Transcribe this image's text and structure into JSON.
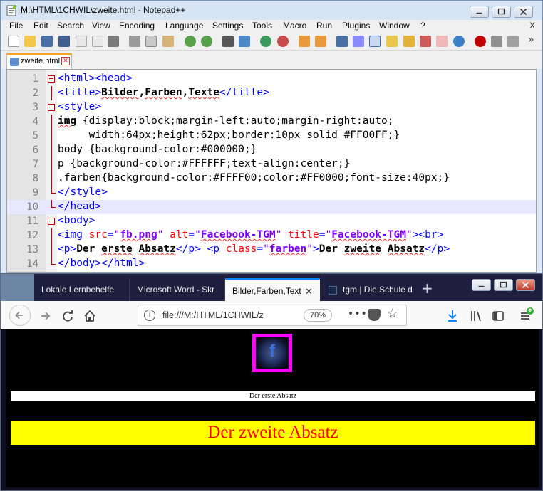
{
  "notepad": {
    "title": "M:\\HTML\\1CHWIL\\zweite.html - Notepad++",
    "menu": [
      "File",
      "Edit",
      "Search",
      "View",
      "Encoding",
      "Language",
      "Settings",
      "Tools",
      "Macro",
      "Run",
      "Plugins",
      "Window",
      "?"
    ],
    "menu_close": "X",
    "toolbar_overflow": "»",
    "tab": {
      "label": "zweite.html",
      "close": "✕"
    },
    "current_line": 10,
    "lines": [
      {
        "n": "1",
        "fold": "box",
        "parts": [
          [
            "tag",
            "<html><head>"
          ]
        ]
      },
      {
        "n": "2",
        "fold": "vline",
        "parts": [
          [
            "tag",
            "<title>"
          ],
          [
            "bsq",
            "Bilder"
          ],
          [
            "b",
            ","
          ],
          [
            "bsq",
            "Farben"
          ],
          [
            "b",
            ","
          ],
          [
            "bsq",
            "Texte"
          ],
          [
            "tag",
            "</title>"
          ]
        ]
      },
      {
        "n": "3",
        "fold": "box",
        "parts": [
          [
            "tag",
            "<style>"
          ]
        ]
      },
      {
        "n": "4",
        "fold": "vline",
        "parts": [
          [
            "bsq",
            "img"
          ],
          [
            "plain",
            " {display:block;margin-left:auto;margin-right:auto;"
          ]
        ]
      },
      {
        "n": "5",
        "fold": "vline",
        "parts": [
          [
            "plain",
            "     width:64px;height:62px;border:10px solid #FF00FF;}"
          ]
        ]
      },
      {
        "n": "6",
        "fold": "vline",
        "parts": [
          [
            "plain",
            "body {background-color:#000000;}"
          ]
        ]
      },
      {
        "n": "7",
        "fold": "vline",
        "parts": [
          [
            "plain",
            "p {background-color:#FFFFFF;text-align:center;}"
          ]
        ]
      },
      {
        "n": "8",
        "fold": "vline",
        "parts": [
          [
            "plain",
            ".farben{background-color:#FFFF00;color:#FF0000;font-size:40px;}"
          ]
        ]
      },
      {
        "n": "9",
        "fold": "end",
        "parts": [
          [
            "tag",
            "</style>"
          ]
        ]
      },
      {
        "n": "10",
        "fold": "end",
        "parts": [
          [
            "tag",
            "</head>"
          ]
        ]
      },
      {
        "n": "11",
        "fold": "box",
        "parts": [
          [
            "tag",
            "<body>"
          ]
        ]
      },
      {
        "n": "12",
        "fold": "vline",
        "parts": [
          [
            "tag",
            "<img "
          ],
          [
            "attr",
            "src"
          ],
          [
            "tag",
            "="
          ],
          [
            "str",
            "\""
          ],
          [
            "strsq",
            "fb.png"
          ],
          [
            "str",
            "\""
          ],
          [
            "attr",
            " alt"
          ],
          [
            "tag",
            "="
          ],
          [
            "str",
            "\""
          ],
          [
            "strsq",
            "Facebook-TGM"
          ],
          [
            "str",
            "\""
          ],
          [
            "attr",
            " title"
          ],
          [
            "tag",
            "="
          ],
          [
            "str",
            "\""
          ],
          [
            "strsq",
            "Facebook-TGM"
          ],
          [
            "str",
            "\""
          ],
          [
            "tag",
            "><br>"
          ]
        ]
      },
      {
        "n": "13",
        "fold": "vline",
        "parts": [
          [
            "tag",
            "<p>"
          ],
          [
            "b",
            "Der "
          ],
          [
            "bsq",
            "erste"
          ],
          [
            "b",
            " "
          ],
          [
            "bsq",
            "Absatz"
          ],
          [
            "tag",
            "</p> <p "
          ],
          [
            "attr",
            "class"
          ],
          [
            "tag",
            "="
          ],
          [
            "str",
            "\""
          ],
          [
            "strsq",
            "farben"
          ],
          [
            "str",
            "\""
          ],
          [
            "tag",
            ">"
          ],
          [
            "b",
            "Der "
          ],
          [
            "bsq",
            "zweite"
          ],
          [
            "b",
            " "
          ],
          [
            "bsq",
            "Absatz"
          ],
          [
            "tag",
            "</p>"
          ]
        ]
      },
      {
        "n": "14",
        "fold": "end",
        "parts": [
          [
            "tag",
            "</body></html>"
          ]
        ]
      }
    ]
  },
  "firefox": {
    "tabs": [
      "Lokale Lernbehelfe",
      "Microsoft Word - Skr",
      "Bilder,Farben,Text",
      "tgm | Die Schule d"
    ],
    "active_tab": 2,
    "tab_close": "✕",
    "new_tab": "+",
    "url": "file:///M:/HTML/1CHWIL/z",
    "zoom": "70%",
    "info": "i",
    "more": "•••",
    "star": "☆",
    "page": {
      "image_alt": "Facebook-TGM",
      "image_glyph": "f",
      "para1": "Der erste Absatz",
      "para2": "Der zweite Absatz"
    }
  },
  "colors": {
    "magenta_border": "#FF00FF",
    "page_bg": "#000000",
    "para_bg": "#FFFFFF",
    "farben_bg": "#FFFF00",
    "farben_text": "#FF0000"
  }
}
